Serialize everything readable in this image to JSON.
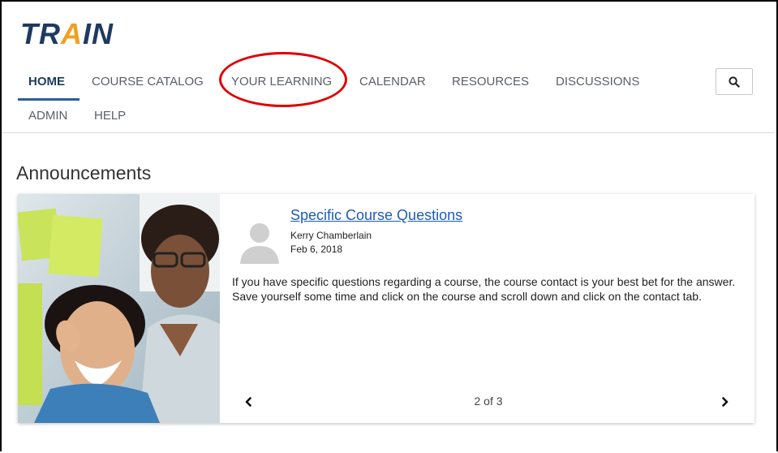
{
  "logo": {
    "pre": "TR",
    "accent": "A",
    "post": "IN",
    "brand_color": "#1f3a5f",
    "accent_color": "#f0a020"
  },
  "nav": {
    "items": [
      {
        "label": "HOME",
        "active": true
      },
      {
        "label": "COURSE CATALOG",
        "active": false
      },
      {
        "label": "YOUR LEARNING",
        "active": false,
        "highlighted": true
      },
      {
        "label": "CALENDAR",
        "active": false
      },
      {
        "label": "RESOURCES",
        "active": false
      },
      {
        "label": "DISCUSSIONS",
        "active": false
      },
      {
        "label": "ADMIN",
        "active": false
      },
      {
        "label": "HELP",
        "active": false
      }
    ],
    "search_icon": "search-icon"
  },
  "announcements": {
    "title": "Announcements",
    "item": {
      "title": "Specific Course Questions",
      "author": "Kerry Chamberlain",
      "date": "Feb 6, 2018",
      "body": "If you have specific questions regarding a course, the course contact is your best bet for the answer. Save yourself some time and click on the course and scroll down and click on the contact tab."
    },
    "pager": {
      "text": "2 of 3",
      "prev_icon": "chevron-left-icon",
      "next_icon": "chevron-right-icon"
    }
  },
  "colors": {
    "link": "#1e5bb8",
    "active_nav": "#2a5d9f",
    "annotation_circle": "#e00000"
  }
}
